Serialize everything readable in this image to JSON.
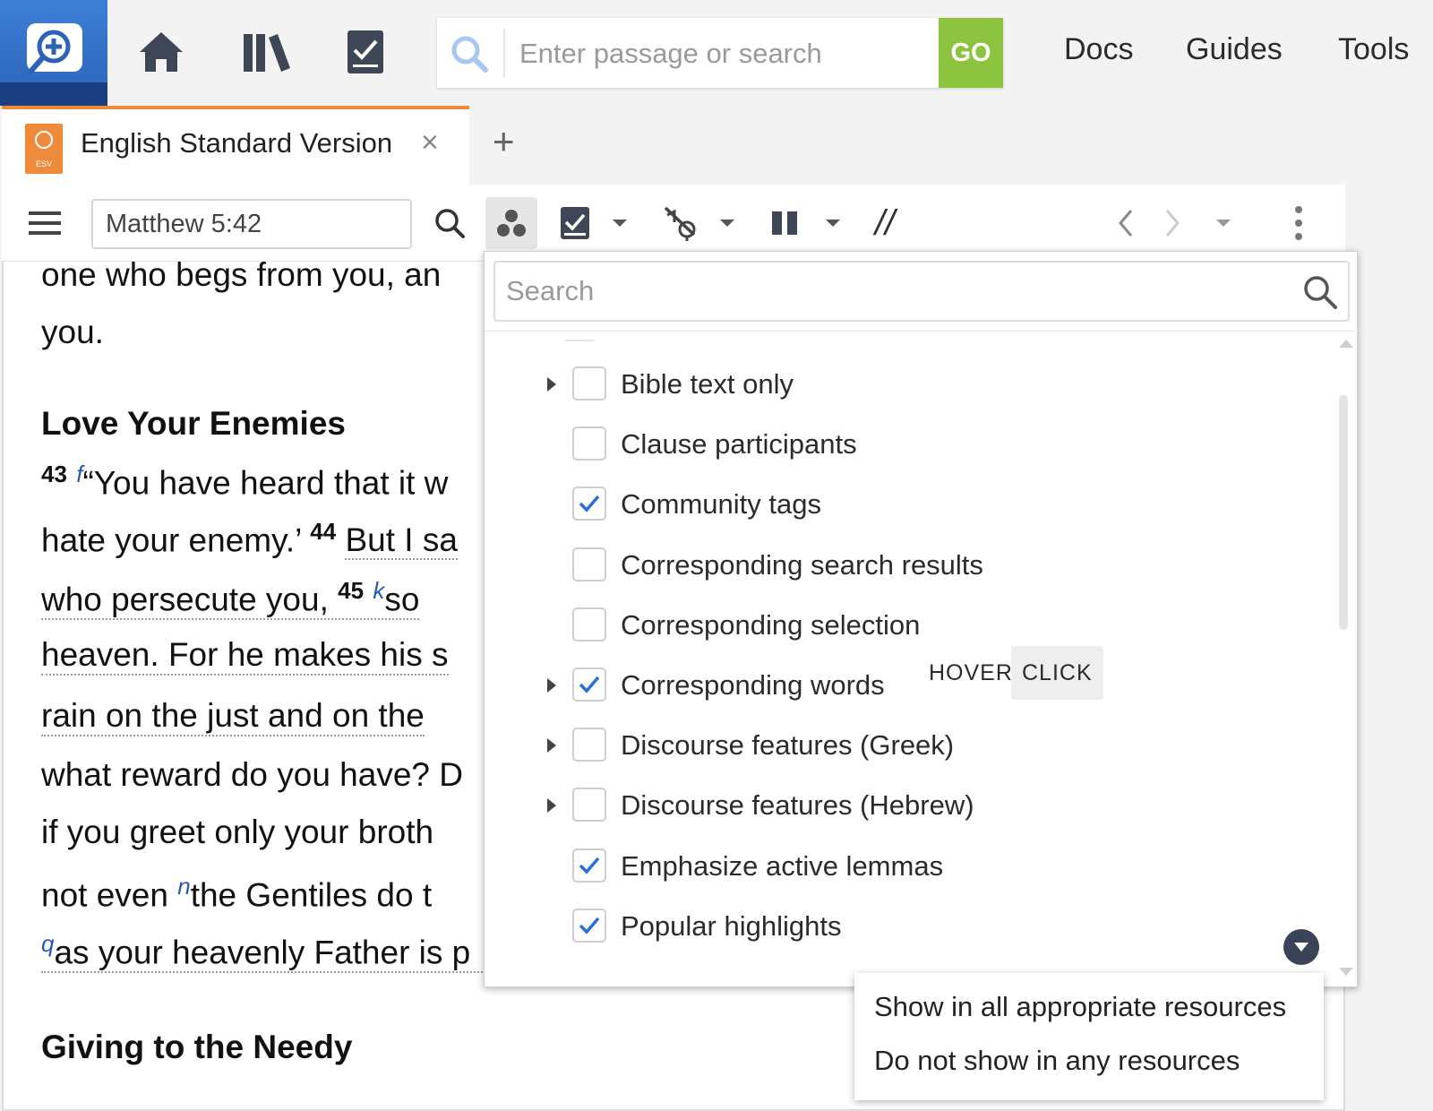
{
  "app": {
    "nav_icons": [
      "logos-search-logo-icon",
      "home-icon",
      "library-icon",
      "checklist-icon"
    ],
    "search": {
      "placeholder": "Enter passage or search",
      "go_label": "GO"
    },
    "links": [
      "Docs",
      "Guides",
      "Tools"
    ]
  },
  "tab": {
    "badge": "ESV",
    "title": "English Standard Version",
    "close": "×",
    "add": "+"
  },
  "toolbar": {
    "reference": "Matthew 5:42",
    "icons": [
      "menu-icon",
      "search-icon",
      "visual-filters-icon",
      "highlight-icon",
      "interlinear-icon",
      "columns-icon",
      "parallel-icon",
      "back-icon",
      "forward-icon",
      "more-icon"
    ],
    "parallel_label": "//"
  },
  "bible_text": {
    "line1": "one who begs from you, an",
    "line2": "you.",
    "heading1": "Love Your Enemies",
    "v43": "43",
    "fn_f": "f",
    "line3_text": "“You have heard that it w",
    "line4_a": "hate your enemy.’",
    "v44": "44",
    "line4_b": "But I sa",
    "line5_a": "who persecute you,",
    "v45": "45",
    "fn_k": "k",
    "line5_b": "so",
    "line6": "heaven. For he makes his s",
    "line7": "rain on the just and on the",
    "line8": "what reward do you have? D",
    "line9": "if you greet only your broth",
    "line10_a": "not even",
    "fn_n": "n",
    "line10_b": "the Gentiles do t",
    "fn_q": "q",
    "line11": "as your heavenly Father is p",
    "heading2": "Giving to the Needy"
  },
  "visual_filters": {
    "search_placeholder": "Search",
    "items": [
      {
        "label": "Bible text only",
        "checked": false,
        "expandable": true
      },
      {
        "label": "Clause participants",
        "checked": false,
        "expandable": false
      },
      {
        "label": "Community tags",
        "checked": true,
        "expandable": false
      },
      {
        "label": "Corresponding search results",
        "checked": false,
        "expandable": false
      },
      {
        "label": "Corresponding selection",
        "checked": false,
        "expandable": false
      },
      {
        "label": "Corresponding words",
        "checked": true,
        "expandable": true
      },
      {
        "label": "Discourse features (Greek)",
        "checked": false,
        "expandable": true
      },
      {
        "label": "Discourse features (Hebrew)",
        "checked": false,
        "expandable": true
      },
      {
        "label": "Emphasize active lemmas",
        "checked": true,
        "expandable": false
      },
      {
        "label": "Popular highlights",
        "checked": true,
        "expandable": false
      }
    ],
    "hover_label": "HOVER",
    "click_label": "CLICK",
    "check_color": "#2b6fd4"
  },
  "context_menu": {
    "show_all": "Show in all appropriate resources",
    "hide_all": "Do not show in any resources"
  },
  "colors": {
    "brand_blue": "#2a63b8",
    "go_green": "#8cc43f",
    "tab_orange": "#f08b3a"
  }
}
